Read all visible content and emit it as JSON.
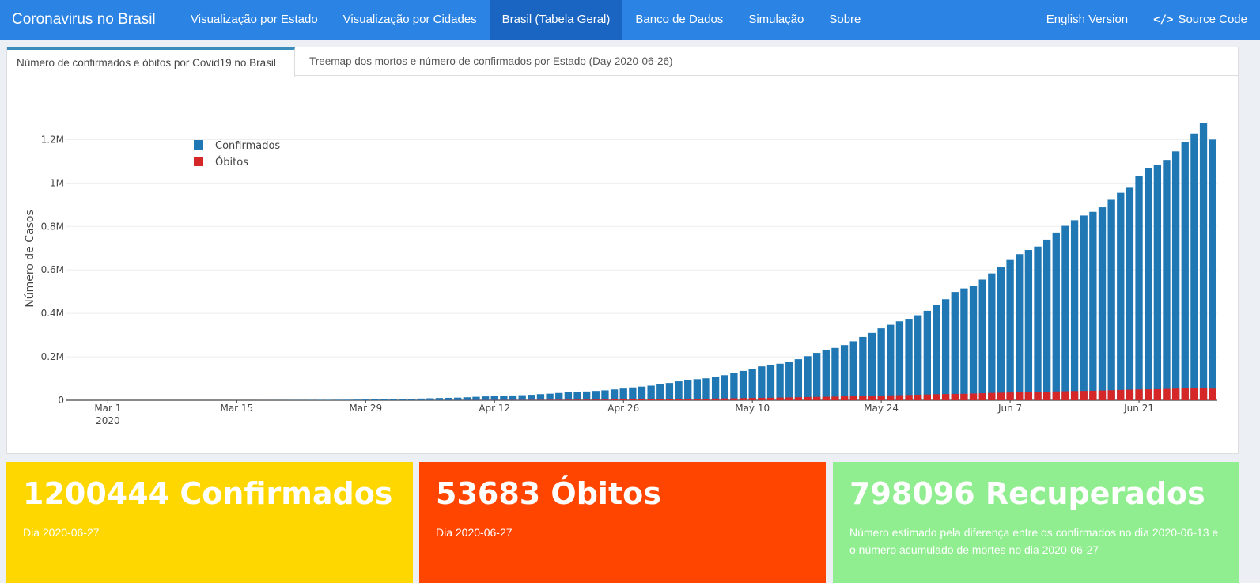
{
  "navbar": {
    "brand": "Coronavirus no Brasil",
    "items": [
      "Visualização por Estado",
      "Visualização por Cidades",
      "Brasil (Tabela Geral)",
      "Banco de Dados",
      "Simulação",
      "Sobre"
    ],
    "english": "English Version",
    "source": "Source Code",
    "code_glyph": "</>",
    "colors": {
      "bar": "#2b83e3",
      "active": "#1a64c2"
    }
  },
  "tabs": {
    "tab1": "Número de confirmados e óbitos por Covid19 no Brasil",
    "tab2": "Treemap dos mortos e número de confirmados por Estado (Day 2020-06-26)"
  },
  "chart_data": {
    "type": "bar",
    "ylabel": "Número de Casos",
    "yticks": [
      {
        "v": 0,
        "label": "0"
      },
      {
        "v": 200000,
        "label": "0.2M"
      },
      {
        "v": 400000,
        "label": "0.4M"
      },
      {
        "v": 600000,
        "label": "0.6M"
      },
      {
        "v": 800000,
        "label": "0.8M"
      },
      {
        "v": 1000000,
        "label": "1M"
      },
      {
        "v": 1200000,
        "label": "1.2M"
      }
    ],
    "xticks": [
      {
        "day": 4,
        "label": "Mar 1",
        "label2": "2020"
      },
      {
        "day": 18,
        "label": "Mar 15"
      },
      {
        "day": 32,
        "label": "Mar 29"
      },
      {
        "day": 46,
        "label": "Apr 12"
      },
      {
        "day": 60,
        "label": "Apr 26"
      },
      {
        "day": 74,
        "label": "May 10"
      },
      {
        "day": 88,
        "label": "May 24"
      },
      {
        "day": 102,
        "label": "Jun 7"
      },
      {
        "day": 116,
        "label": "Jun 21"
      }
    ],
    "ylim": [
      0,
      1300000
    ],
    "legend_position": "top-left",
    "series": [
      {
        "name": "Confirmados",
        "color": "#1f77b4",
        "values": [
          0,
          0,
          0,
          1,
          1,
          1,
          1,
          2,
          2,
          2,
          2,
          3,
          8,
          13,
          25,
          25,
          34,
          52,
          77,
          98,
          121,
          200,
          291,
          428,
          621,
          904,
          1128,
          1546,
          1891,
          2201,
          2433,
          2915,
          3417,
          3904,
          4256,
          4579,
          5717,
          6836,
          7910,
          9056,
          10278,
          11130,
          12056,
          13717,
          15927,
          17857,
          19638,
          20727,
          22169,
          23430,
          25262,
          28320,
          30425,
          33682,
          36599,
          38654,
          40581,
          43079,
          45757,
          50036,
          54043,
          59324,
          63100,
          67446,
          73235,
          79685,
          87187,
          92202,
          97100,
          101147,
          108620,
          115455,
          126611,
          135106,
          145328,
          155939,
          162699,
          168331,
          177589,
          188974,
          202918,
          218223,
          233142,
          241080,
          254220,
          271628,
          291579,
          310087,
          330890,
          347398,
          363211,
          374898,
          391222,
          411821,
          438238,
          465166,
          498440,
          514849,
          526447,
          555383,
          584016,
          614941,
          645771,
          672846,
          691758,
          707412,
          739503,
          772416,
          802828,
          828810,
          850514,
          867624,
          888271,
          923189,
          955377,
          978142,
          1032913,
          1067579,
          1085038,
          1106470,
          1145906,
          1188631,
          1228114,
          1274974,
          1200444
        ]
      },
      {
        "name": "Óbitos",
        "color": "#d62728",
        "values": [
          0,
          0,
          0,
          0,
          0,
          0,
          0,
          0,
          0,
          0,
          0,
          0,
          0,
          0,
          0,
          0,
          0,
          0,
          0,
          0,
          0,
          0,
          0,
          0,
          6,
          11,
          18,
          25,
          34,
          46,
          59,
          77,
          92,
          114,
          136,
          159,
          201,
          241,
          299,
          359,
          432,
          486,
          553,
          667,
          800,
          941,
          1056,
          1124,
          1223,
          1328,
          1532,
          1736,
          1924,
          2141,
          2361,
          2462,
          2587,
          2741,
          2906,
          3331,
          3704,
          4057,
          4286,
          4603,
          5083,
          5513,
          6329,
          6750,
          7025,
          7343,
          7921,
          8536,
          9146,
          9897,
          10627,
          11123,
          11519,
          12400,
          13149,
          13993,
          14817,
          15633,
          16118,
          16792,
          17971,
          18859,
          20047,
          21048,
          22013,
          22666,
          23473,
          24512,
          25598,
          26754,
          27878,
          28834,
          29314,
          29937,
          31199,
          32548,
          34021,
          35026,
          35930,
          36455,
          37134,
          38406,
          39680,
          40919,
          41828,
          42720,
          43332,
          44118,
          45241,
          46510,
          47748,
          48954,
          49976,
          50617,
          51271,
          52645,
          53830,
          54971,
          55961,
          57070,
          53683
        ]
      }
    ]
  },
  "boxes": {
    "confirmados": {
      "title": "1200444 Confirmados",
      "sub": "Dia 2020-06-27",
      "color": "#ffd700"
    },
    "obitos": {
      "title": "53683 Óbitos",
      "sub": "Dia 2020-06-27",
      "color": "#ff4500"
    },
    "recuperados": {
      "title": "798096 Recuperados",
      "sub": "Número estimado pela diferença entre os confirmados no dia 2020-06-13 e o número acumulado de mortes no dia 2020-06-27",
      "color": "#90ee90"
    }
  }
}
